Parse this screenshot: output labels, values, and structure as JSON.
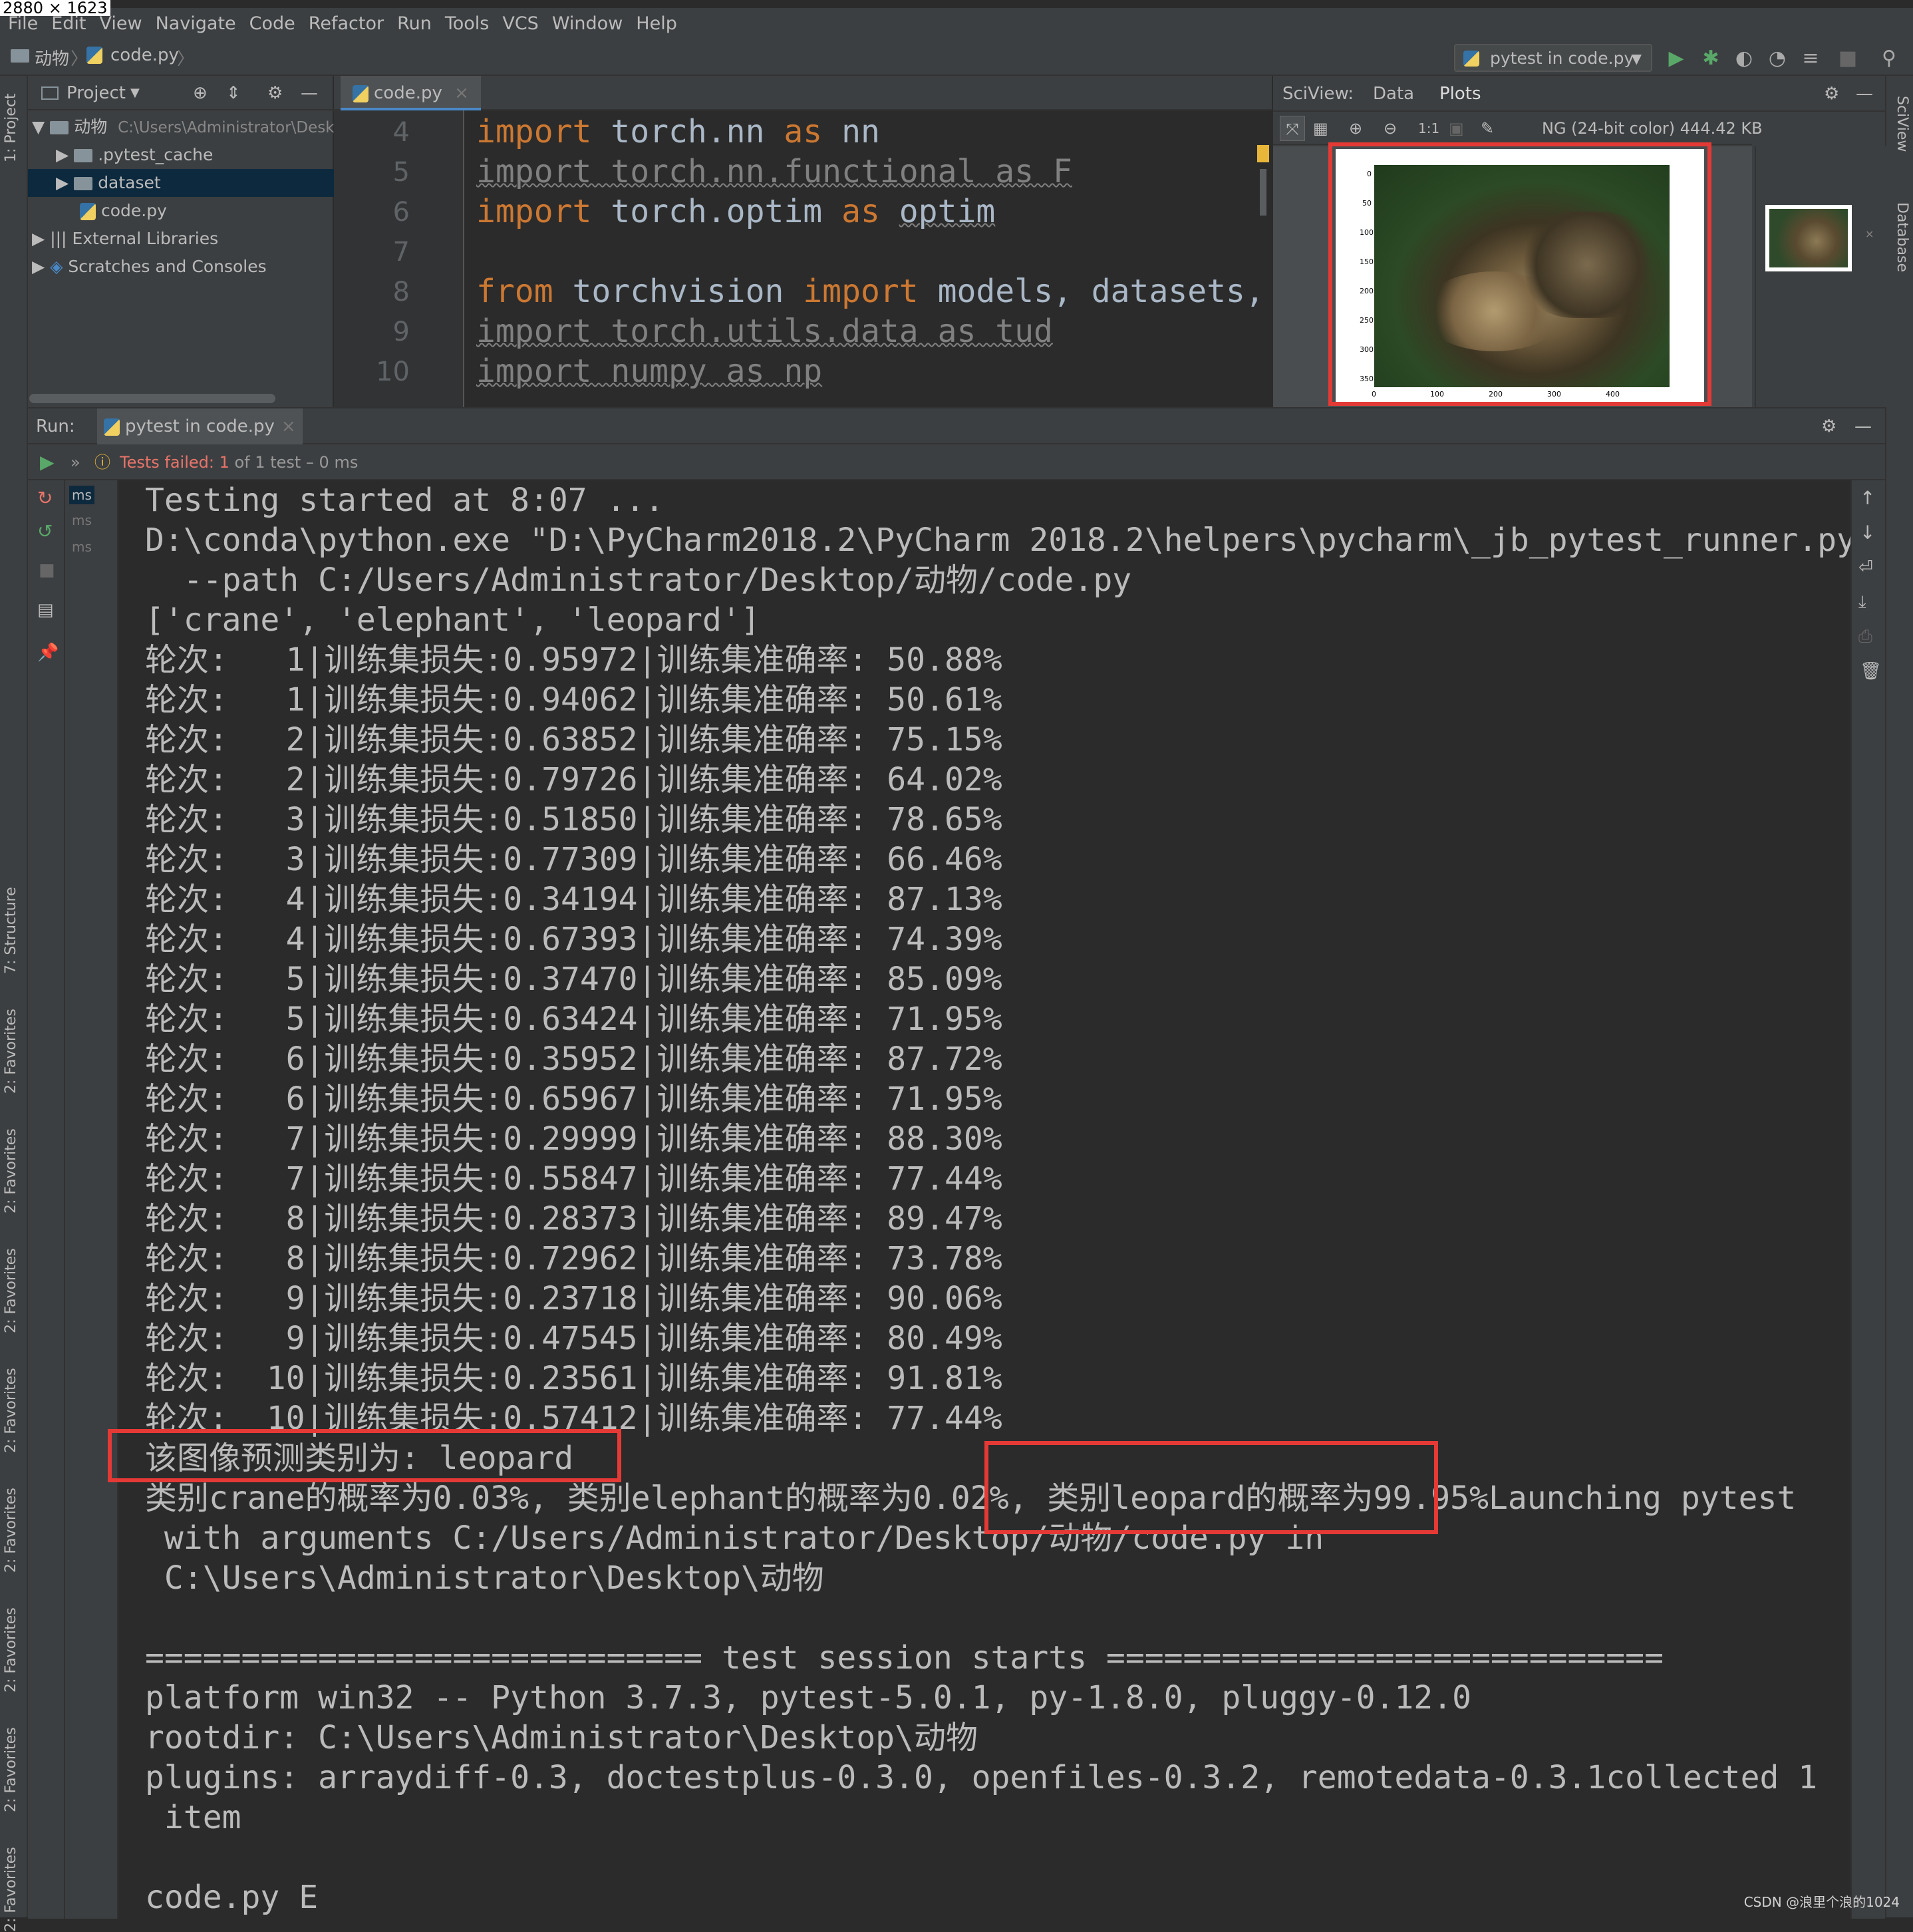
{
  "screen_size_label": "2880 × 1623",
  "menu": [
    "File",
    "Edit",
    "View",
    "Navigate",
    "Code",
    "Refactor",
    "Run",
    "Tools",
    "VCS",
    "Window",
    "Help"
  ],
  "breadcrumb": {
    "folder": "动物",
    "file": "code.py"
  },
  "run_config": "pytest in code.py",
  "left_strip": {
    "project": "1: Project",
    "structure": "7: Structure",
    "favorites": [
      "2: Favorites",
      "2: Favorites",
      "2: Favorites",
      "2: Favorites",
      "2: Favorites",
      "2: Favorites",
      "2: Favorites",
      "2: Favorites"
    ]
  },
  "right_strip": {
    "sciview": "SciView",
    "database": "Database"
  },
  "project": {
    "header": "Project",
    "tree": [
      {
        "label": "动物",
        "path": "C:\\Users\\Administrator\\Desk"
      },
      {
        "label": ".pytest_cache"
      },
      {
        "label": "dataset"
      },
      {
        "label": "code.py"
      },
      {
        "label": "External Libraries"
      },
      {
        "label": "Scratches and Consoles"
      }
    ]
  },
  "editor": {
    "tab": "code.py",
    "line_numbers": [
      "4",
      "5",
      "6",
      "7",
      "8",
      "9",
      "10"
    ],
    "lines": [
      [
        "import",
        " torch.nn ",
        "as",
        " nn"
      ],
      [
        "import torch.nn.functional as F"
      ],
      [
        "import",
        " torch.optim ",
        "as",
        " ",
        "optim"
      ],
      [
        ""
      ],
      [
        "from",
        " torchvision ",
        "import",
        " models, datasets, tra"
      ],
      [
        "import torch.utils.data as tud"
      ],
      [
        "import numpy as np"
      ]
    ]
  },
  "sciview": {
    "title": "SciView:",
    "tabs": [
      "Data",
      "Plots"
    ],
    "image_info": "NG (24-bit color) 444.42 KB",
    "zoom_label": "1:1",
    "plot_yticks": [
      "0",
      "50",
      "100",
      "150",
      "200",
      "250",
      "300",
      "350"
    ],
    "plot_xticks": [
      "0",
      "100",
      "200",
      "300",
      "400"
    ]
  },
  "run": {
    "label": "Run:",
    "tab": "pytest in code.py",
    "status_failed": "Tests failed:",
    "status_count": "1",
    "status_rest": "of 1 test – 0 ms",
    "ms_labels": [
      "ms",
      "ms",
      "ms"
    ],
    "console": [
      "Testing started at 8:07 ...",
      "D:\\conda\\python.exe \"D:\\PyCharm2018.2\\PyCharm 2018.2\\helpers\\pycharm\\_jb_pytest_runner.py\"",
      "  --path C:/Users/Administrator/Desktop/动物/code.py",
      "['crane', 'elephant', 'leopard']",
      "轮次:   1|训练集损失:0.95972|训练集准确率: 50.88%",
      "轮次:   1|训练集损失:0.94062|训练集准确率: 50.61%",
      "轮次:   2|训练集损失:0.63852|训练集准确率: 75.15%",
      "轮次:   2|训练集损失:0.79726|训练集准确率: 64.02%",
      "轮次:   3|训练集损失:0.51850|训练集准确率: 78.65%",
      "轮次:   3|训练集损失:0.77309|训练集准确率: 66.46%",
      "轮次:   4|训练集损失:0.34194|训练集准确率: 87.13%",
      "轮次:   4|训练集损失:0.67393|训练集准确率: 74.39%",
      "轮次:   5|训练集损失:0.37470|训练集准确率: 85.09%",
      "轮次:   5|训练集损失:0.63424|训练集准确率: 71.95%",
      "轮次:   6|训练集损失:0.35952|训练集准确率: 87.72%",
      "轮次:   6|训练集损失:0.65967|训练集准确率: 71.95%",
      "轮次:   7|训练集损失:0.29999|训练集准确率: 88.30%",
      "轮次:   7|训练集损失:0.55847|训练集准确率: 77.44%",
      "轮次:   8|训练集损失:0.28373|训练集准确率: 89.47%",
      "轮次:   8|训练集损失:0.72962|训练集准确率: 73.78%",
      "轮次:   9|训练集损失:0.23718|训练集准确率: 90.06%",
      "轮次:   9|训练集损失:0.47545|训练集准确率: 80.49%",
      "轮次:  10|训练集损失:0.23561|训练集准确率: 91.81%",
      "轮次:  10|训练集损失:0.57412|训练集准确率: 77.44%",
      "该图像预测类别为: leopard",
      "类别crane的概率为0.03%, 类别elephant的概率为0.02%, 类别leopard的概率为99.95%Launching pytest",
      " with arguments C:/Users/Administrator/Desktop/动物/code.py in",
      " C:\\Users\\Administrator\\Desktop\\动物",
      "",
      "============================= test session starts =============================",
      "platform win32 -- Python 3.7.3, pytest-5.0.1, py-1.8.0, pluggy-0.12.0",
      "rootdir: C:\\Users\\Administrator\\Desktop\\动物",
      "plugins: arraydiff-0.3, doctestplus-0.3.0, openfiles-0.3.2, remotedata-0.3.1collected 1",
      " item",
      "",
      "code.py E"
    ]
  },
  "watermark": "CSDN @浪里个浪的1024",
  "colors": {
    "keyword": "#cc7832",
    "highlight": "#e53935",
    "failed": "#e8746a",
    "run_green": "#59a869"
  }
}
